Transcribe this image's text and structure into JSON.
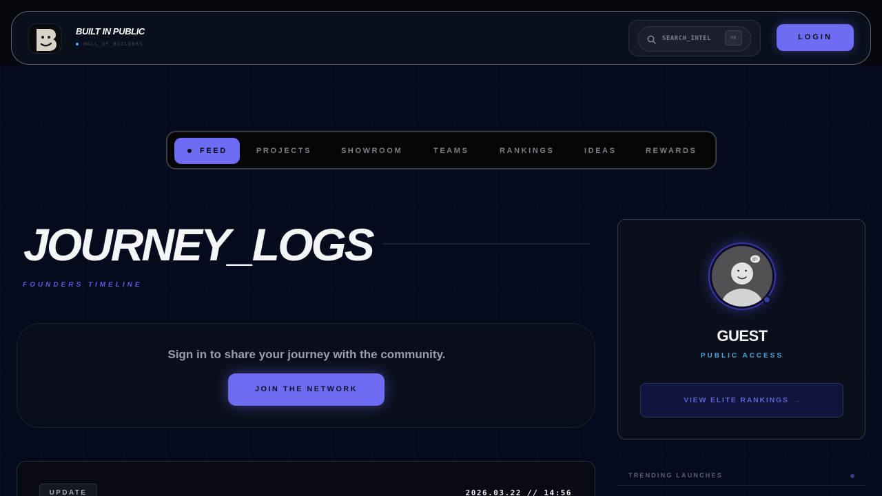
{
  "header": {
    "brand_title": "BUILT IN PUBLIC",
    "brand_subtitle": "HALL_OF_BUILDERS",
    "logo_icon": "b-logo-icon",
    "search": {
      "label": "SEARCH_INTEL",
      "shortcut": "⌘K",
      "icon": "search-icon"
    },
    "login_label": "LOGIN"
  },
  "nav": {
    "items": [
      {
        "label": "FEED",
        "active": true
      },
      {
        "label": "PROJECTS",
        "active": false
      },
      {
        "label": "SHOWROOM",
        "active": false
      },
      {
        "label": "TEAMS",
        "active": false
      },
      {
        "label": "RANKINGS",
        "active": false
      },
      {
        "label": "IDEAS",
        "active": false
      },
      {
        "label": "REWARDS",
        "active": false
      }
    ]
  },
  "hero": {
    "title": "JOURNEY_LOGS",
    "subtitle": "FOUNDERS TIMELINE"
  },
  "signin": {
    "prompt": "Sign in to share your journey with the community.",
    "button_label": "JOIN THE NETWORK"
  },
  "feed": {
    "first_post": {
      "tag": "UPDATE",
      "timestamp": "2026.03.22 // 14:56"
    }
  },
  "profile": {
    "name": "GUEST",
    "role": "PUBLIC ACCESS",
    "elite_button_label": "VIEW ELITE RANKINGS",
    "elite_button_arrow": "→",
    "avatar_icon": "guest-avatar-icon"
  },
  "sidebar": {
    "trending_title": "TRENDING LAUNCHES"
  },
  "colors": {
    "accent": "#6d6cf2",
    "background": "#050a1c",
    "info_blue": "#4aa6dc"
  }
}
